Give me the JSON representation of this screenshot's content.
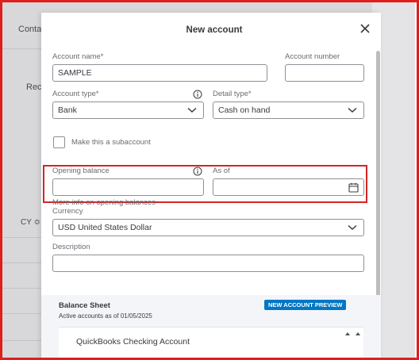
{
  "background": {
    "tab_label": "Conta",
    "column_label": "Rec",
    "sort_label": "CY ≎"
  },
  "modal": {
    "title": "New account",
    "close_icon": "close-icon"
  },
  "form": {
    "account_name": {
      "label": "Account name*",
      "value": "SAMPLE"
    },
    "account_number": {
      "label": "Account number",
      "value": ""
    },
    "account_type": {
      "label": "Account type*",
      "value": "Bank",
      "info_icon": "info-icon"
    },
    "detail_type": {
      "label": "Detail type*",
      "value": "Cash on hand"
    },
    "subaccount": {
      "label": "Make this a subaccount",
      "checked": false
    },
    "opening_balance": {
      "label": "Opening balance",
      "value": "",
      "info_icon": "info-icon"
    },
    "as_of": {
      "label": "As of",
      "value": "",
      "icon": "calendar-icon"
    },
    "more_info_link": "More info on opening balances",
    "currency": {
      "label": "Currency",
      "value": "USD United States Dollar"
    },
    "description": {
      "label": "Description",
      "value": ""
    }
  },
  "preview": {
    "title": "Balance Sheet",
    "subtitle": "Active accounts as of 01/05/2025",
    "badge": "NEW ACCOUNT PREVIEW",
    "first_account": "QuickBooks Checking Account"
  },
  "colors": {
    "highlight": "#d42424",
    "badge": "#0077c5",
    "frame": "#e01e1e"
  }
}
